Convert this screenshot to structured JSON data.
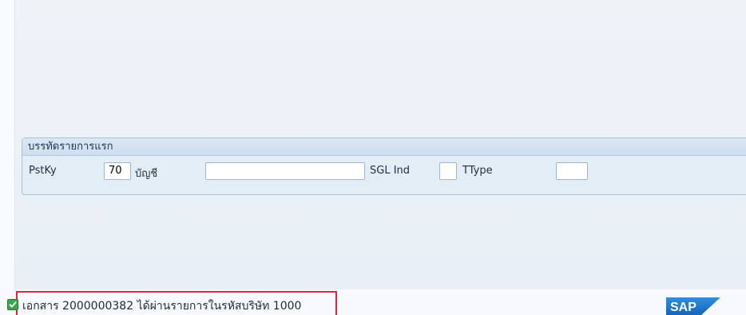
{
  "group": {
    "title": "บรรทัดรายการแรก"
  },
  "fields": {
    "pstky_label": "PstKy",
    "pstky_value": "70",
    "account_label": "บัญชี",
    "account_value": "",
    "sgl_label": "SGL Ind",
    "sgl_value": "",
    "ttype_label": "TType",
    "ttype_value": ""
  },
  "status": {
    "message": "เอกสาร 2000000382 ได้ผ่านรายการในรหัสบริษัท 1000",
    "icon": "success-check-icon",
    "highlight_color": "#e0263a"
  },
  "brand": {
    "logo_text": "SAP",
    "logo_color": "#1a73c8"
  }
}
